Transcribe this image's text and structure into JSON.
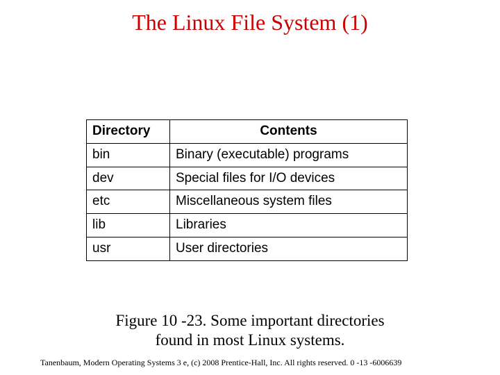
{
  "title": "The Linux File System (1)",
  "table": {
    "headers": {
      "col1": "Directory",
      "col2": "Contents"
    },
    "rows": [
      {
        "dir": "bin",
        "contents": "Binary (executable) programs"
      },
      {
        "dir": "dev",
        "contents": "Special files for I/O devices"
      },
      {
        "dir": "etc",
        "contents": "Miscellaneous system files"
      },
      {
        "dir": "lib",
        "contents": "Libraries"
      },
      {
        "dir": "usr",
        "contents": "User directories"
      }
    ]
  },
  "caption_line1": "Figure 10 -23. Some important directories",
  "caption_line2": "found in most Linux systems.",
  "footer": "Tanenbaum, Modern Operating Systems 3 e, (c) 2008 Prentice-Hall, Inc. All rights reserved. 0 -13 -6006639"
}
